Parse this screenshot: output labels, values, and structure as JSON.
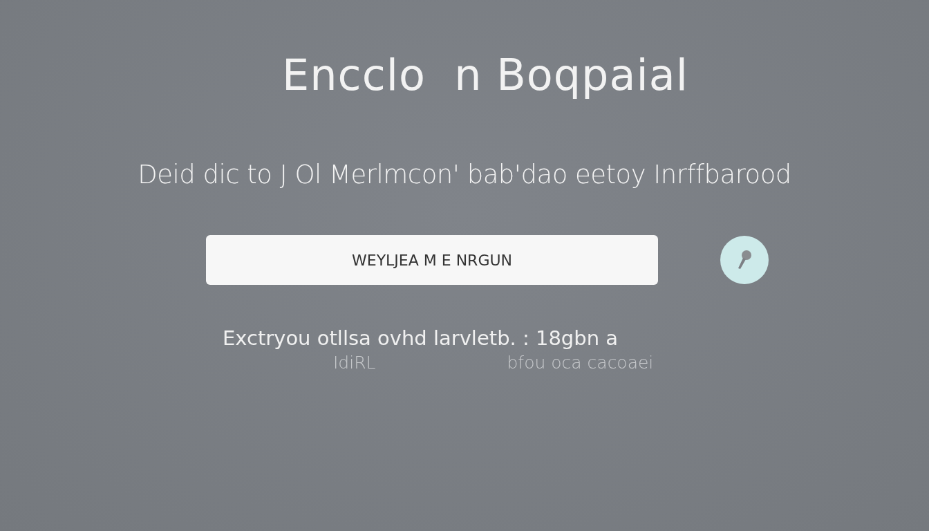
{
  "title": "Encclo  n Boqpaial",
  "subtitle": "Deid dic to J Ol Merlmcon' bab'dao eetoy Inrffbarood",
  "search": {
    "value": "WEYLJEA M E NRGUN"
  },
  "note": {
    "line": "Exctryou otllsa ovhd larvletb. : 18gbn a",
    "captions": [
      "IdiRL",
      "bfou oca cacoaei"
    ]
  }
}
